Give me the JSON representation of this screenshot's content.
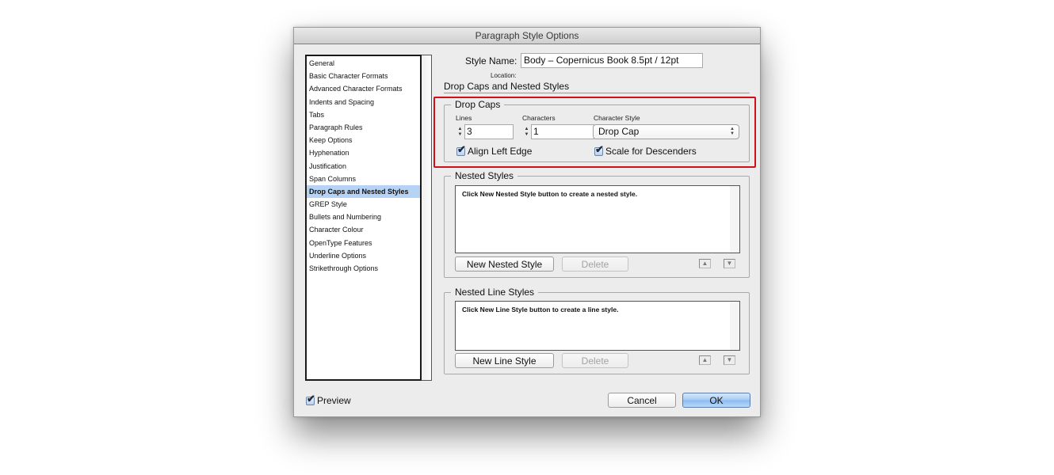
{
  "window": {
    "title": "Paragraph Style Options"
  },
  "sidebar": {
    "selected_index": 10,
    "items": [
      {
        "label": "General"
      },
      {
        "label": "Basic Character Formats"
      },
      {
        "label": "Advanced Character Formats"
      },
      {
        "label": "Indents and Spacing"
      },
      {
        "label": "Tabs"
      },
      {
        "label": "Paragraph Rules"
      },
      {
        "label": "Keep Options"
      },
      {
        "label": "Hyphenation"
      },
      {
        "label": "Justification"
      },
      {
        "label": "Span Columns"
      },
      {
        "label": "Drop Caps and Nested Styles"
      },
      {
        "label": "GREP Style"
      },
      {
        "label": "Bullets and Numbering"
      },
      {
        "label": "Character Colour"
      },
      {
        "label": "OpenType Features"
      },
      {
        "label": "Underline Options"
      },
      {
        "label": "Strikethrough Options"
      }
    ]
  },
  "header": {
    "style_name_label": "Style Name:",
    "style_name_value": "Body – Copernicus Book  8.5pt / 12pt",
    "location_label": "Location:",
    "section_title": "Drop Caps and Nested Styles"
  },
  "drop_caps": {
    "title": "Drop Caps",
    "lines_label": "Lines",
    "lines_value": "3",
    "characters_label": "Characters",
    "characters_value": "1",
    "character_style_label": "Character Style",
    "character_style_value": "Drop Cap",
    "align_left_edge_label": "Align Left Edge",
    "align_left_edge_checked": true,
    "scale_descenders_label": "Scale for Descenders",
    "scale_descenders_checked": true,
    "highlight_color": "#d0111b"
  },
  "nested_styles": {
    "title": "Nested Styles",
    "hint": "Click New Nested Style button to create a nested style.",
    "new_button": "New Nested Style",
    "delete_button": "Delete"
  },
  "nested_line_styles": {
    "title": "Nested Line Styles",
    "hint": "Click New Line Style button to create a line style.",
    "new_button": "New Line Style",
    "delete_button": "Delete"
  },
  "footer": {
    "preview_label": "Preview",
    "preview_checked": true,
    "cancel_button": "Cancel",
    "ok_button": "OK"
  },
  "icons": {
    "stepper_up": "▲",
    "stepper_down": "▼",
    "move_up": "▲",
    "move_down": "▼",
    "select_arrows": "▲▼",
    "checkmark": "✔"
  }
}
